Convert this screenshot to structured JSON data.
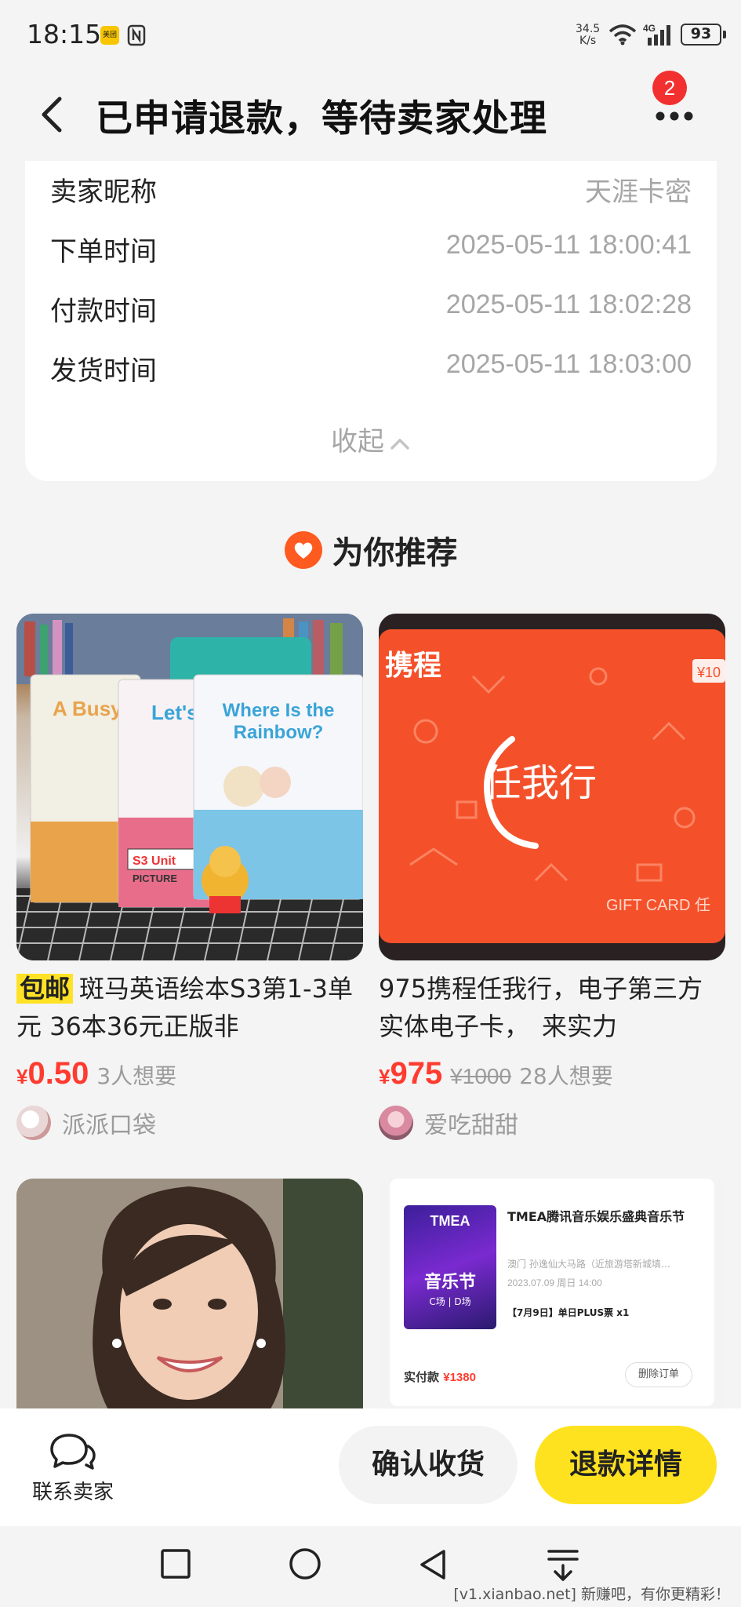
{
  "status_bar": {
    "time": "18:15",
    "meituan_badge": "美团",
    "speed_value": "34.5",
    "speed_unit": "K/s",
    "network": "4G",
    "battery": "93"
  },
  "header": {
    "title": "已申请退款，等待卖家处理",
    "badge_count": "2"
  },
  "order_info": {
    "rows": [
      {
        "label": "卖家昵称",
        "value": "天涯卡密"
      },
      {
        "label": "下单时间",
        "value": "2025-05-11 18:00:41"
      },
      {
        "label": "付款时间",
        "value": "2025-05-11 18:02:28"
      },
      {
        "label": "发货时间",
        "value": "2025-05-11 18:03:00"
      }
    ],
    "collapse_label": "收起"
  },
  "recommend": {
    "title": "为你推荐",
    "items": [
      {
        "tag": "包邮",
        "title": "斑马英语绘本S3第1-3单元 36本36元正版非",
        "price_symbol": "¥",
        "price": "0.50",
        "old_price": "",
        "wants": "3人想要",
        "seller": "派派口袋",
        "image_text_1": "A Busy",
        "image_text_2": "Let's",
        "image_text_3": "Where Is the Rainbow?",
        "image_text_4": "S3 Unit",
        "image_text_5": "PICTURE"
      },
      {
        "tag": "",
        "title": "975携程任我行，电子第三方实体电子卡，　来实力",
        "price_symbol": "¥",
        "price": "975",
        "old_price": "¥1000",
        "wants": "28人想要",
        "seller": "爱吃甜甜",
        "image_text_1": "携程",
        "image_text_2": "任我行",
        "image_text_3": "GIFT CARD 任",
        "image_text_4": "¥10"
      },
      {
        "title": "",
        "image_desc": "portrait"
      },
      {
        "title": "",
        "ticket_title": "TMEA腾讯音乐娱乐盛典音乐节",
        "ticket_venue": "澳门 孙逸仙大马路（近旅游塔新城填…",
        "ticket_date": "2023.07.09 周日 14:00",
        "ticket_desc": "【7月9日】单日PLUS票 x1",
        "ticket_paid_label": "实付款",
        "ticket_paid": "¥1380",
        "ticket_delete": "删除订单",
        "poster_brand": "TMEA",
        "poster_title": "音乐节",
        "poster_sub": "C场 | D场"
      }
    ]
  },
  "bottom_bar": {
    "contact_label": "联系卖家",
    "confirm_label": "确认收货",
    "refund_label": "退款详情"
  },
  "watermark": "[v1.xianbao.net] 新赚吧，有你更精彩！",
  "colors": {
    "accent_yellow": "#ffe21f",
    "price_red": "#ff3b2f",
    "badge_red": "#f23030"
  }
}
